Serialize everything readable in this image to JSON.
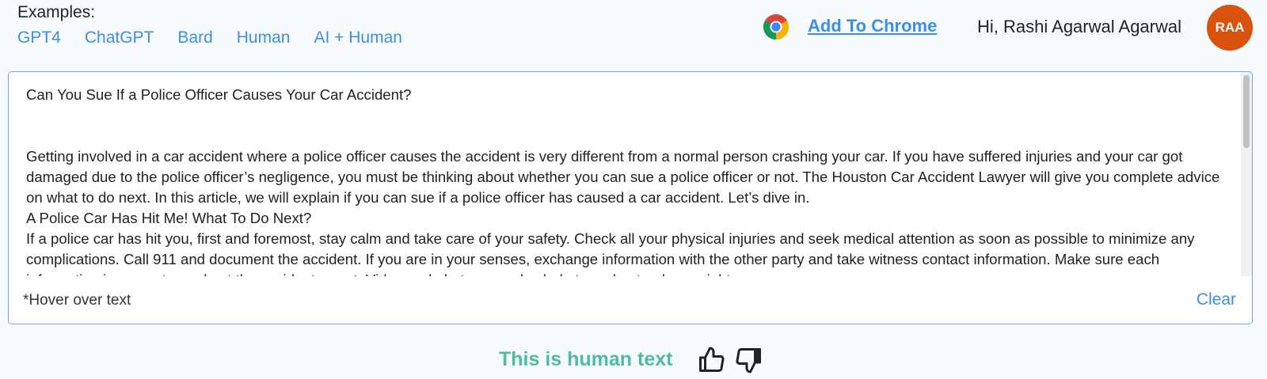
{
  "header": {
    "examples_label": "Examples:",
    "examples": [
      "GPT4",
      "ChatGPT",
      "Bard",
      "Human",
      "AI + Human"
    ],
    "add_to_chrome": "Add To Chrome",
    "greeting": "Hi, Rashi Agarwal Agarwal",
    "avatar_initials": "RAA"
  },
  "editor": {
    "title": "Can You Sue If a Police Officer Causes Your Car Accident?",
    "paragraphs": [
      "Getting involved in a car accident where a police officer causes the accident is very different from a normal person crashing your car. If you have suffered injuries and your car got damaged due to the police officer’s negligence, you must be thinking about whether you can sue a police officer or not. The Houston Car Accident Lawyer will give you complete advice on what to do next. In this article, we will explain if you can sue if a police officer has caused a car accident. Let’s dive in.",
      "A Police Car Has Hit Me! What To Do Next?",
      "If a police car has hit you, first and foremost, stay calm and take care of your safety. Check all your physical injuries and seek medical attention as soon as possible to minimize any complications. Call 911 and document the accident. If you are in your senses, exchange information with the other party and take witness contact information. Make sure each information is accurate, and get the accident report. Video and photos can also help to understand your rights."
    ],
    "hover_hint": "*Hover over text",
    "clear_label": "Clear"
  },
  "result": {
    "label": "This is human text",
    "color": "#4dbca2"
  },
  "colors": {
    "accent": "#3d8ee6",
    "avatar": "#d9530f"
  },
  "icons": [
    "chrome-icon",
    "thumbs-up-icon",
    "thumbs-down-icon"
  ]
}
